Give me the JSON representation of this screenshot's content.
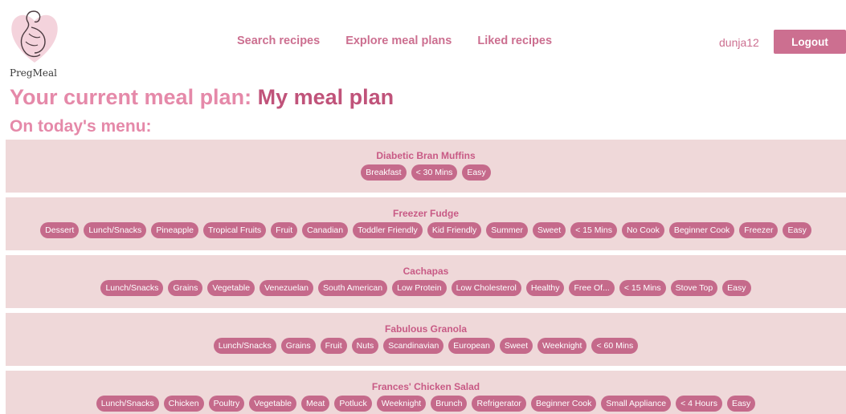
{
  "brand": {
    "name": "PregMeal"
  },
  "nav": {
    "search": "Search recipes",
    "explore": "Explore meal plans",
    "liked": "Liked recipes"
  },
  "user": {
    "username": "dunja12",
    "logout_label": "Logout"
  },
  "page": {
    "plan_prefix": "Your current meal plan:",
    "plan_name": "My meal plan",
    "menu_heading": "On today's menu:"
  },
  "colors": {
    "accent": "#cc6f90",
    "card_bg": "#efd8d9",
    "tag_bg": "#c56a8b"
  },
  "recipes": [
    {
      "name": "Diabetic Bran Muffins",
      "tags": [
        "Breakfast",
        "< 30 Mins",
        "Easy"
      ]
    },
    {
      "name": "Freezer Fudge",
      "tags": [
        "Dessert",
        "Lunch/Snacks",
        "Pineapple",
        "Tropical Fruits",
        "Fruit",
        "Canadian",
        "Toddler Friendly",
        "Kid Friendly",
        "Summer",
        "Sweet",
        "< 15 Mins",
        "No Cook",
        "Beginner Cook",
        "Freezer",
        "Easy"
      ]
    },
    {
      "name": "Cachapas",
      "tags": [
        "Lunch/Snacks",
        "Grains",
        "Vegetable",
        "Venezuelan",
        "South American",
        "Low Protein",
        "Low Cholesterol",
        "Healthy",
        "Free Of...",
        "< 15 Mins",
        "Stove Top",
        "Easy"
      ]
    },
    {
      "name": "Fabulous Granola",
      "tags": [
        "Lunch/Snacks",
        "Grains",
        "Fruit",
        "Nuts",
        "Scandinavian",
        "European",
        "Sweet",
        "Weeknight",
        "< 60 Mins"
      ]
    },
    {
      "name": "Frances' Chicken Salad",
      "tags": [
        "Lunch/Snacks",
        "Chicken",
        "Poultry",
        "Vegetable",
        "Meat",
        "Potluck",
        "Weeknight",
        "Brunch",
        "Refrigerator",
        "Beginner Cook",
        "Small Appliance",
        "< 4 Hours",
        "Easy"
      ]
    }
  ]
}
